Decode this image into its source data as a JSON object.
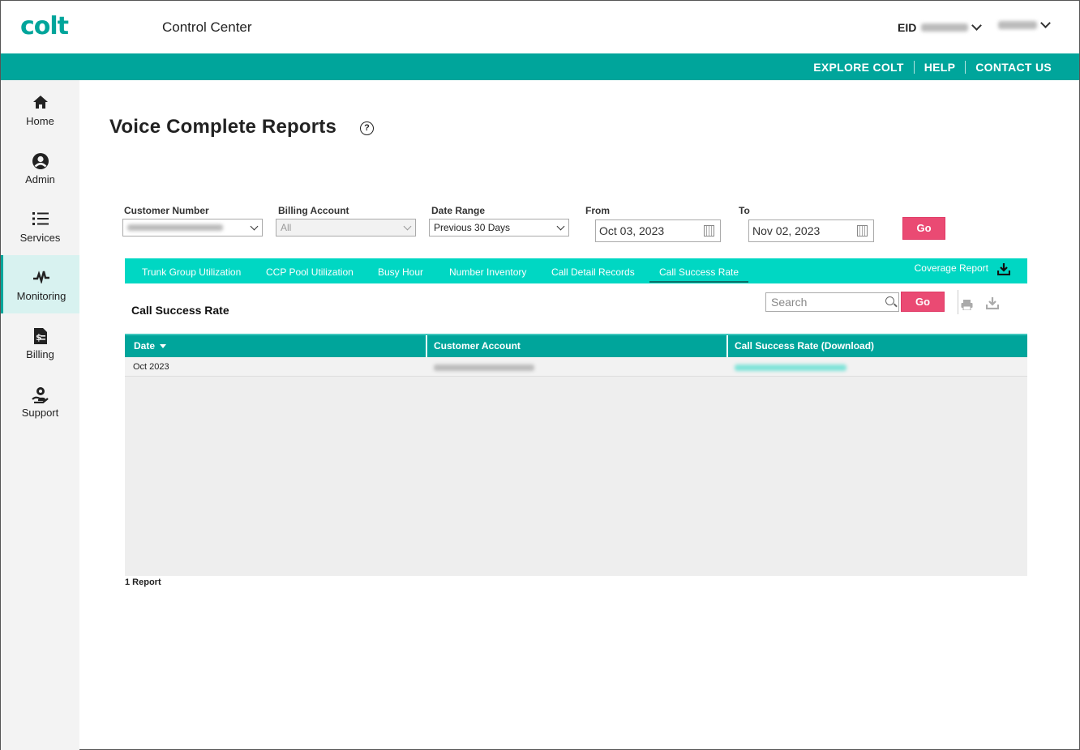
{
  "header": {
    "logo": "colt",
    "app_title": "Control Center",
    "eid_label": "EID",
    "links": [
      "EXPLORE COLT",
      "HELP",
      "CONTACT US"
    ]
  },
  "sidebar": {
    "items": [
      {
        "label": "Home",
        "icon": "home-icon"
      },
      {
        "label": "Admin",
        "icon": "user-icon"
      },
      {
        "label": "Services",
        "icon": "list-icon"
      },
      {
        "label": "Monitoring",
        "icon": "pulse-icon",
        "active": true
      },
      {
        "label": "Billing",
        "icon": "invoice-icon"
      },
      {
        "label": "Support",
        "icon": "support-icon"
      }
    ]
  },
  "page": {
    "title": "Voice Complete Reports",
    "help_icon": "?"
  },
  "filters": {
    "customer_number_label": "Customer Number",
    "billing_account_label": "Billing Account",
    "billing_account_value": "All",
    "date_range_label": "Date Range",
    "date_range_value": "Previous 30 Days",
    "from_label": "From",
    "from_value": "Oct 03, 2023",
    "to_label": "To",
    "to_value": "Nov 02, 2023",
    "go_label": "Go"
  },
  "tabs": {
    "items": [
      "Trunk Group Utilization",
      "CCP Pool Utilization",
      "Busy Hour",
      "Number Inventory",
      "Call Detail Records",
      "Call Success Rate"
    ],
    "active": "Call Success Rate",
    "coverage_report": "Coverage Report"
  },
  "report": {
    "section_title": "Call Success Rate",
    "search_placeholder": "Search",
    "go_label": "Go",
    "columns": [
      "Date",
      "Customer Account",
      "Call Success Rate (Download)"
    ],
    "rows": [
      {
        "date": "Oct 2023"
      }
    ],
    "count_text": "1 Report"
  },
  "colors": {
    "brand": "#00a59b",
    "tab_bar": "#00d7c3",
    "go_button": "#ea4a73"
  }
}
